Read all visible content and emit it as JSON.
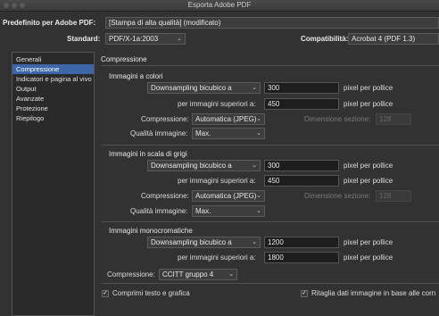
{
  "window": {
    "title": "Esporta Adobe PDF"
  },
  "header": {
    "preset_label": "Predefinito per Adobe PDF:",
    "preset_value": "[Stampa di alta qualità] (modificato)",
    "standard_label": "Standard:",
    "standard_value": "PDF/X-1a:2003",
    "compat_label": "Compatibilità:",
    "compat_value": "Acrobat 4 (PDF 1.3)"
  },
  "sidebar": {
    "items": [
      {
        "label": "Generali"
      },
      {
        "label": "Compressione"
      },
      {
        "label": "Indicatori e pagina al vivo"
      },
      {
        "label": "Output"
      },
      {
        "label": "Avanzate"
      },
      {
        "label": "Protezione"
      },
      {
        "label": "Riepilogo"
      }
    ],
    "active_index": 1
  },
  "panel": {
    "title": "Compressione",
    "color": {
      "title": "Immagini a colori",
      "downsampling": "Downsampling bicubico a",
      "ppi_value": "300",
      "ppi_unit": "pixel per pollice",
      "above_label": "per immagini superiori a:",
      "above_value": "450",
      "above_unit": "pixel per pollice",
      "comp_label": "Compressione:",
      "comp_value": "Automatica (JPEG)",
      "tile_label": "Dimensione sezione:",
      "tile_value": "128",
      "quality_label": "Qualità immagine:",
      "quality_value": "Max."
    },
    "gray": {
      "title": "Immagini in scala di grigi",
      "downsampling": "Downsampling bicubico a",
      "ppi_value": "300",
      "ppi_unit": "pixel per pollice",
      "above_label": "per immagini superiori a:",
      "above_value": "450",
      "above_unit": "pixel per pollice",
      "comp_label": "Compressione:",
      "comp_value": "Automatica (JPEG)",
      "tile_label": "Dimensione sezione:",
      "tile_value": "128",
      "quality_label": "Qualità immagine:",
      "quality_value": "Max."
    },
    "mono": {
      "title": "Immagini monocromatiche",
      "downsampling": "Downsampling bicubico a",
      "ppi_value": "1200",
      "ppi_unit": "pixel per pollice",
      "above_label": "per immagini superiori a:",
      "above_value": "1800",
      "above_unit": "pixel per pollice",
      "comp_label": "Compressione:",
      "comp_value": "CCITT gruppo 4"
    },
    "compress_text": "Comprimi testo e grafica",
    "crop_data": "Ritaglia dati immagine in base alle corn"
  }
}
